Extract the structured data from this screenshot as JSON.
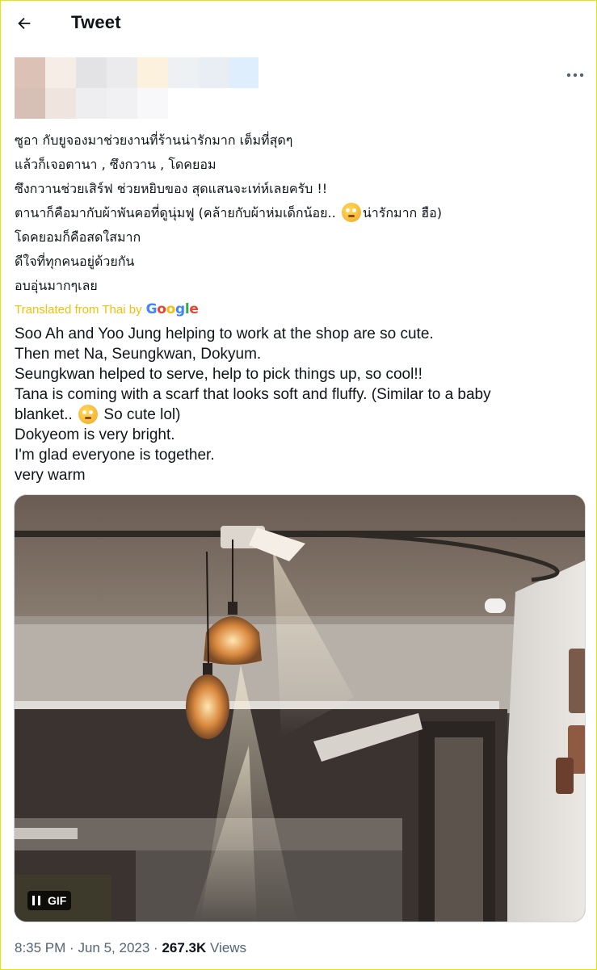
{
  "header": {
    "title": "Tweet"
  },
  "tweet": {
    "thai_lines": [
      "ซูอา กับยูจองมาช่วยงานที่ร้านน่ารักมาก เต็มที่สุดๆ",
      "แล้วก็เจอตานา , ซึงกวาน , โดคยอม",
      "ซึงกวานช่วยเสิร์ฟ ช่วยหยิบของ สุดแสนจะเท่ห์เลยครับ !!",
      "ตานาก็คือมากับผ้าพันคอที่ดูนุ่มฟู (คล้ายกับผ้าห่มเด็กน้อย..",
      "น่ารักมาก ฮือ)",
      "โดคยอมก็คือสดใสมาก",
      "ดีใจที่ทุกคนอยู่ด้วยกัน",
      "อบอุ่นมากๆเลย"
    ],
    "translated_label": "Translated from Thai by",
    "translator": "Google",
    "english_lines": [
      "Soo Ah and Yoo Jung helping to work at the shop are so cute.",
      "Then met Na, Seungkwan, Dokyum.",
      "Seungkwan helped to serve, help to pick things up, so cool!!",
      "Tana is coming with a scarf that looks soft and fluffy. (Similar to a baby",
      "blanket..",
      "So cute lol)",
      "Dokyeom is very bright.",
      "I'm glad everyone is together.",
      "very warm"
    ],
    "media": {
      "badge": "GIF",
      "state": "playing"
    },
    "time": "8:35 PM",
    "sep": "·",
    "date": "Jun 5, 2023",
    "views_count": "267.3K",
    "views_label": "Views"
  },
  "icons": {
    "back": "arrow-left-icon",
    "more": "more-horizontal-icon",
    "emoji": "face-with-rolling-eyes-emoji",
    "pause": "pause-icon"
  },
  "colors": {
    "text": "#0f1419",
    "secondary": "#536471",
    "translated": "#f2c00b",
    "frame": "#e6e600",
    "google_blue": "#4285F4",
    "google_red": "#EA4335",
    "google_yellow": "#FBBC05",
    "google_green": "#34A853"
  }
}
